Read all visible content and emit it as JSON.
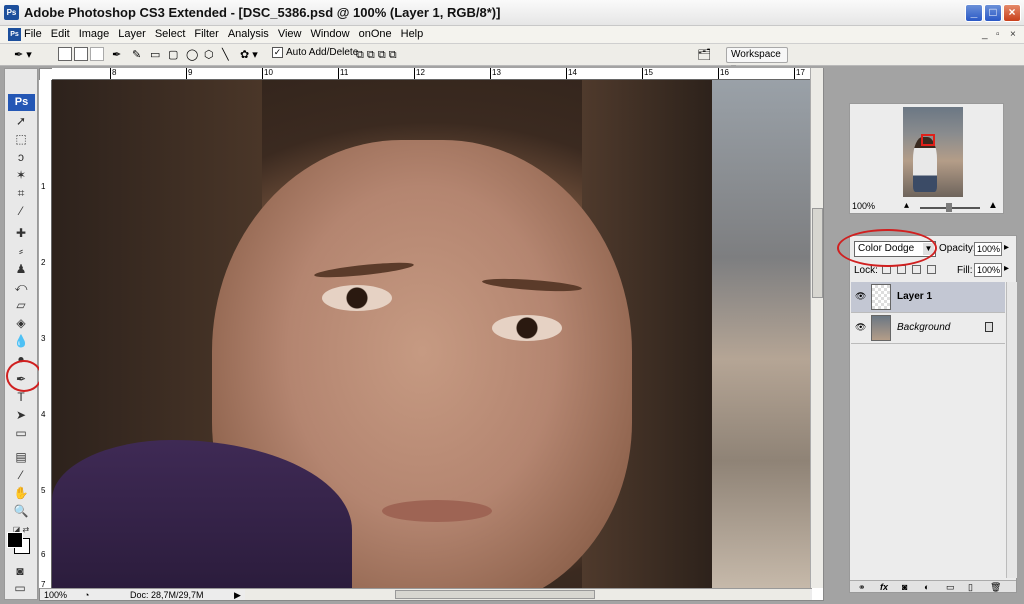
{
  "window": {
    "title": "Adobe Photoshop CS3 Extended - [DSC_5386.psd @ 100% (Layer 1, RGB/8*)]",
    "app_icon": "Ps"
  },
  "menu": [
    "File",
    "Edit",
    "Image",
    "Layer",
    "Select",
    "Filter",
    "Analysis",
    "View",
    "Window",
    "onOne",
    "Help"
  ],
  "options_bar": {
    "auto_add_delete": "Auto Add/Delete",
    "auto_add_checked": true,
    "workspace": "Workspace"
  },
  "rulers": {
    "top": [
      "8",
      "9",
      "10",
      "11",
      "12",
      "13",
      "14",
      "15",
      "16",
      "17"
    ],
    "left": [
      "1",
      "2",
      "3",
      "4",
      "5",
      "6",
      "7"
    ]
  },
  "tools": {
    "logo": "Ps",
    "icons": [
      "move-icon",
      "marquee-icon",
      "lasso-icon",
      "magic-wand-icon",
      "crop-icon",
      "slice-icon",
      "healing-icon",
      "brush-icon",
      "stamp-icon",
      "history-brush-icon",
      "eraser-icon",
      "bucket-icon",
      "blur-icon",
      "dodge-icon",
      "pen-icon",
      "type-icon",
      "path-select-icon",
      "shape-icon",
      "notes-icon",
      "eyedropper-icon",
      "hand-icon",
      "zoom-icon"
    ],
    "selected": "pen-icon",
    "foreground_color": "#000000",
    "background_color": "#ffffff"
  },
  "status": {
    "zoom": "100%",
    "doc": "Doc: 28,7M/29,7M"
  },
  "navigator": {
    "zoom": "100%"
  },
  "layers": {
    "blend_mode": "Color Dodge",
    "opacity_label": "Opacity:",
    "opacity": "100%",
    "lock_label": "Lock:",
    "fill_label": "Fill:",
    "fill": "100%",
    "items": [
      {
        "name": "Layer 1",
        "selected": true,
        "visible": true
      },
      {
        "name": "Background",
        "selected": false,
        "visible": true,
        "locked": true
      }
    ],
    "footer_fx": "fx"
  },
  "annotations": {
    "highlight_color": "#d02020"
  }
}
